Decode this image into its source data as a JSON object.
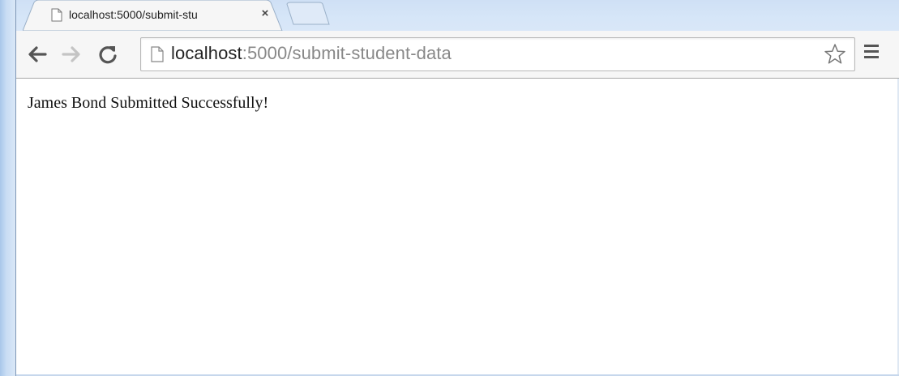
{
  "browser": {
    "tab": {
      "title": "localhost:5000/submit-stu",
      "close_glyph": "×"
    },
    "address_bar": {
      "host": "localhost",
      "rest": ":5000/submit-student-data"
    },
    "icons": [
      "back-arrow-icon",
      "forward-arrow-icon",
      "reload-icon",
      "page-icon",
      "star-icon",
      "menu-icon"
    ]
  },
  "page": {
    "message": "James Bond Submitted Successfully!"
  },
  "colors": {
    "frame": "#c9ddf4",
    "toolbar": "#f6f6f6",
    "url_host": "#222222",
    "url_path": "#888888"
  }
}
